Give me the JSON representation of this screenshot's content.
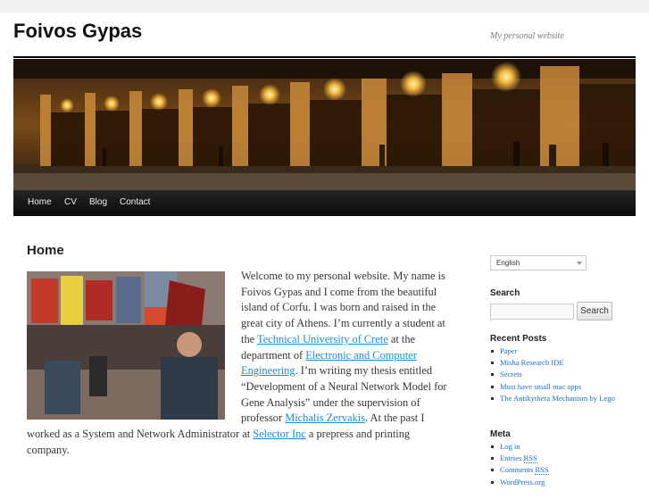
{
  "site": {
    "title": "Foivos Gypas",
    "tagline": "My personal website"
  },
  "nav": {
    "items": [
      {
        "label": "Home"
      },
      {
        "label": "CV"
      },
      {
        "label": "Blog"
      },
      {
        "label": "Contact"
      }
    ]
  },
  "main": {
    "title": "Home",
    "content": {
      "p1": "Welcome to my personal website. My name is Foivos Gypas and I come from the beautiful island of Corfu. I was born and raised in the great city of Athens. I’m currently a student at the ",
      "link_tuc": "Technical University of Crete",
      "p2": " at the department of ",
      "link_ece": "Electronic and Computer Engineering",
      "p3": ". I’m writing my thesis entitled “Development of a Neural Network Model for Gene Analysis” under the supervision of professor ",
      "link_prof": "Michalis Zervakis",
      "p4": ". At the past I worked as a System and Network Administrator at ",
      "link_selector": "Selector Inc",
      "p5": " a prepress and printing company."
    }
  },
  "sidebar": {
    "language": {
      "selected": "English"
    },
    "search": {
      "heading": "Search",
      "button_label": "Search",
      "placeholder": ""
    },
    "recent_posts": {
      "heading": "Recent Posts",
      "items": [
        {
          "label": "Paper"
        },
        {
          "label": "Misha Research IDE"
        },
        {
          "label": "Secrets"
        },
        {
          "label": "Must have small mac apps"
        },
        {
          "label": "The Antikythera Mechanism by Lego"
        }
      ]
    },
    "meta": {
      "heading": "Meta",
      "items": [
        {
          "label": "Log in"
        },
        {
          "label": "Entries RSS",
          "abbr": "RSS",
          "prefix": "Entries "
        },
        {
          "label": "Comments RSS",
          "abbr": "RSS",
          "prefix": "Comments "
        },
        {
          "label": "WordPress.org"
        }
      ]
    }
  },
  "colors": {
    "link": "#1b8be0",
    "nav_bg": "#111111",
    "background": "#f1f1f1"
  }
}
